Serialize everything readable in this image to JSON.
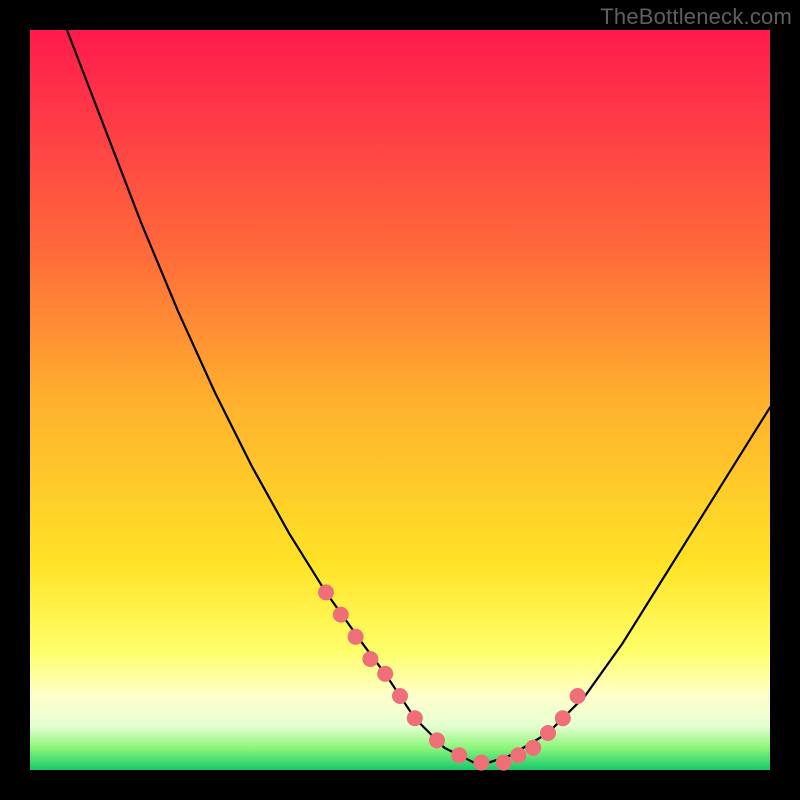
{
  "watermark": "TheBottleneck.com",
  "chart_data": {
    "type": "line",
    "title": "",
    "xlabel": "",
    "ylabel": "",
    "xlim": [
      0,
      100
    ],
    "ylim": [
      0,
      100
    ],
    "grid": false,
    "legend": false,
    "series": [
      {
        "name": "bottleneck-curve",
        "x": [
          5,
          10,
          15,
          20,
          25,
          30,
          35,
          40,
          45,
          48,
          50,
          52,
          54,
          56,
          58,
          60,
          62,
          65,
          70,
          75,
          80,
          85,
          90,
          95,
          100
        ],
        "values": [
          100,
          87,
          74,
          62,
          51,
          41,
          32,
          24,
          17,
          13,
          10,
          7,
          5,
          3,
          2,
          1,
          1,
          2,
          5,
          10,
          17,
          25,
          33,
          41,
          49
        ]
      }
    ],
    "markers": {
      "name": "highlighted-points",
      "color": "#ef6f78",
      "x": [
        40,
        42,
        44,
        46,
        48,
        50,
        52,
        55,
        58,
        61,
        64,
        66,
        68,
        70,
        72,
        74
      ],
      "values": [
        24,
        21,
        18,
        15,
        13,
        10,
        7,
        4,
        2,
        1,
        1,
        2,
        3,
        5,
        7,
        10
      ]
    },
    "background_gradient": {
      "type": "vertical",
      "stops": [
        {
          "pos": 0,
          "color": "#ff1a4d"
        },
        {
          "pos": 50,
          "color": "#ffb02e"
        },
        {
          "pos": 84,
          "color": "#ffff6a"
        },
        {
          "pos": 100,
          "color": "#18c96b"
        }
      ]
    }
  }
}
